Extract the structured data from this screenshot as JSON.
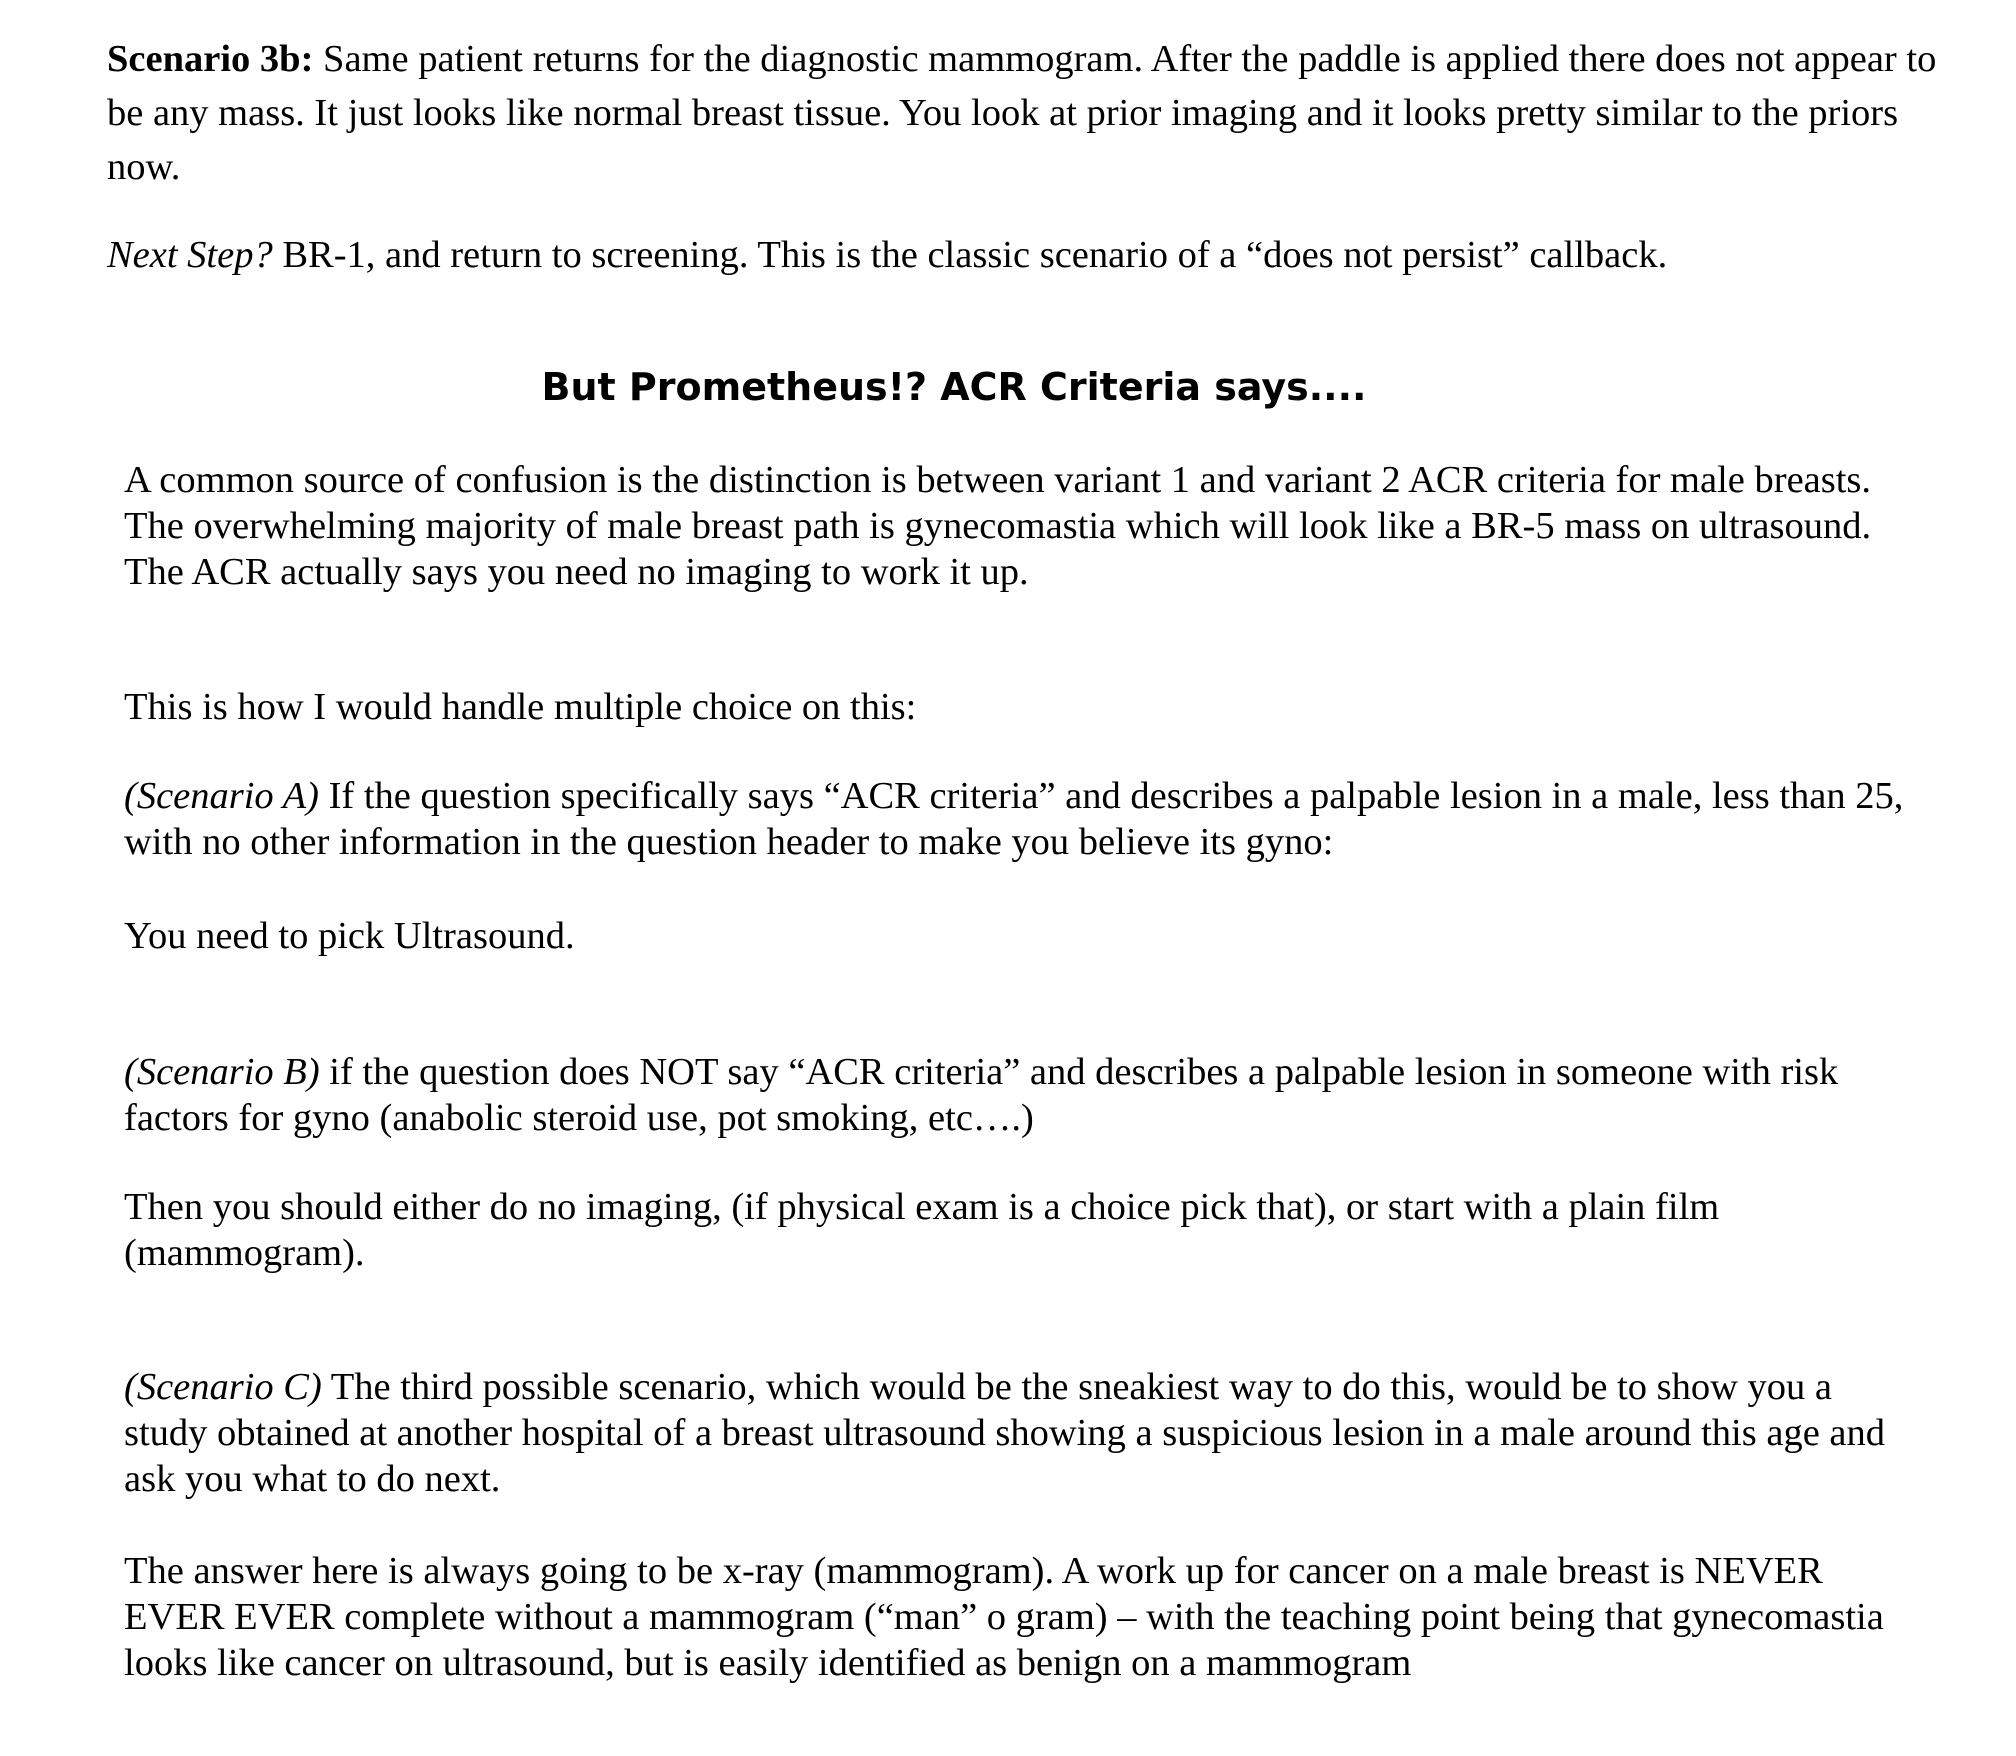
{
  "scenario3b": {
    "label": "Scenario 3b:",
    "text": " Same patient returns for the diagnostic mammogram.  After the paddle is applied there does not appear to be any mass.  It just looks like normal breast tissue.  You look at prior imaging and it looks pretty similar to the priors now."
  },
  "next_step": {
    "label": "Next Step?",
    "text": " BR-1, and return to screening.  This is the classic scenario of a “does not persist” callback."
  },
  "heading": "But Prometheus!? ACR Criteria says....",
  "paragraphs": {
    "confusion": "A common source of confusion is the distinction is between variant 1 and variant 2 ACR criteria for male breasts.  The overwhelming majority of male breast path is gynecomastia which will look like a BR-5 mass on ultrasound.  The ACR actually says you need no imaging to work it up.",
    "intro": "This is how I would handle multiple choice on this:",
    "scenario_a_label": "(Scenario A)",
    "scenario_a_text": " If the question specifically says “ACR criteria” and describes a palpable lesion in a male, less than 25, with no other information in the question header to make you believe its gyno:",
    "scenario_a_answer": "You need to pick Ultrasound.",
    "scenario_b_label": "(Scenario B)",
    "scenario_b_text": " if the question does NOT say “ACR criteria” and describes a palpable lesion in someone with risk factors for gyno (anabolic steroid use, pot smoking, etc….)",
    "scenario_b_answer": "Then you should either do no imaging, (if physical exam is a choice pick that), or start with a plain film (mammogram).",
    "scenario_c_label": "(Scenario C)",
    "scenario_c_text": " The third possible scenario, which would be the sneakiest way to do this, would be to show you a study obtained at another hospital of a breast ultrasound showing a suspicious lesion in a male around this age and ask you what to do next.",
    "scenario_c_answer": "The answer here is always going to be x-ray  (mammogram).  A work up for cancer on a male breast is NEVER EVER EVER complete without a mammogram (“man” o gram) – with the teaching point being that gynecomastia looks like cancer on ultrasound, but is easily identified as benign on a mammogram"
  }
}
